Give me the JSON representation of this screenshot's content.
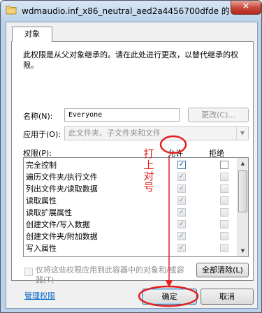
{
  "window": {
    "title": "wdmaudio.inf_x86_neutral_aed2a4456700dfde 的",
    "close_label": "✕"
  },
  "tab": {
    "label": "对象"
  },
  "description": "此权限是从父对象继承的。请在此处进行更改，以替代继承的权限。",
  "name": {
    "label": "名称(N):",
    "value": "Everyone",
    "change_button": "更改(C)..."
  },
  "apply_to": {
    "label": "应用于(O):",
    "value": "此文件夹、子文件夹和文件"
  },
  "permissions": {
    "label": "权限(P):",
    "allow_header": "允许",
    "deny_header": "拒绝",
    "items": [
      {
        "name": "完全控制",
        "allow": true,
        "deny": false
      },
      {
        "name": "遍历文件夹/执行文件",
        "allow": true,
        "deny": false
      },
      {
        "name": "列出文件夹/读取数据",
        "allow": true,
        "deny": false
      },
      {
        "name": "读取属性",
        "allow": true,
        "deny": false
      },
      {
        "name": "读取扩展属性",
        "allow": true,
        "deny": false
      },
      {
        "name": "创建文件/写入数据",
        "allow": true,
        "deny": false
      },
      {
        "name": "创建文件夹/附加数据",
        "allow": true,
        "deny": false
      },
      {
        "name": "写入属性",
        "allow": true,
        "deny": false
      }
    ]
  },
  "only_apply": {
    "label": "仅将这些权限应用到此容器中的对象和/或容器(T)",
    "checked": false
  },
  "clear_all_button": "全部清除(L)",
  "manage_link": "管理权限",
  "ok_button": "确定",
  "cancel_button": "取消",
  "annotation": {
    "text": "打上对号",
    "color": "#e32020"
  },
  "colors": {
    "titlebar": "#bad2ea",
    "annotation": "#e32020",
    "link": "#0066cc"
  }
}
